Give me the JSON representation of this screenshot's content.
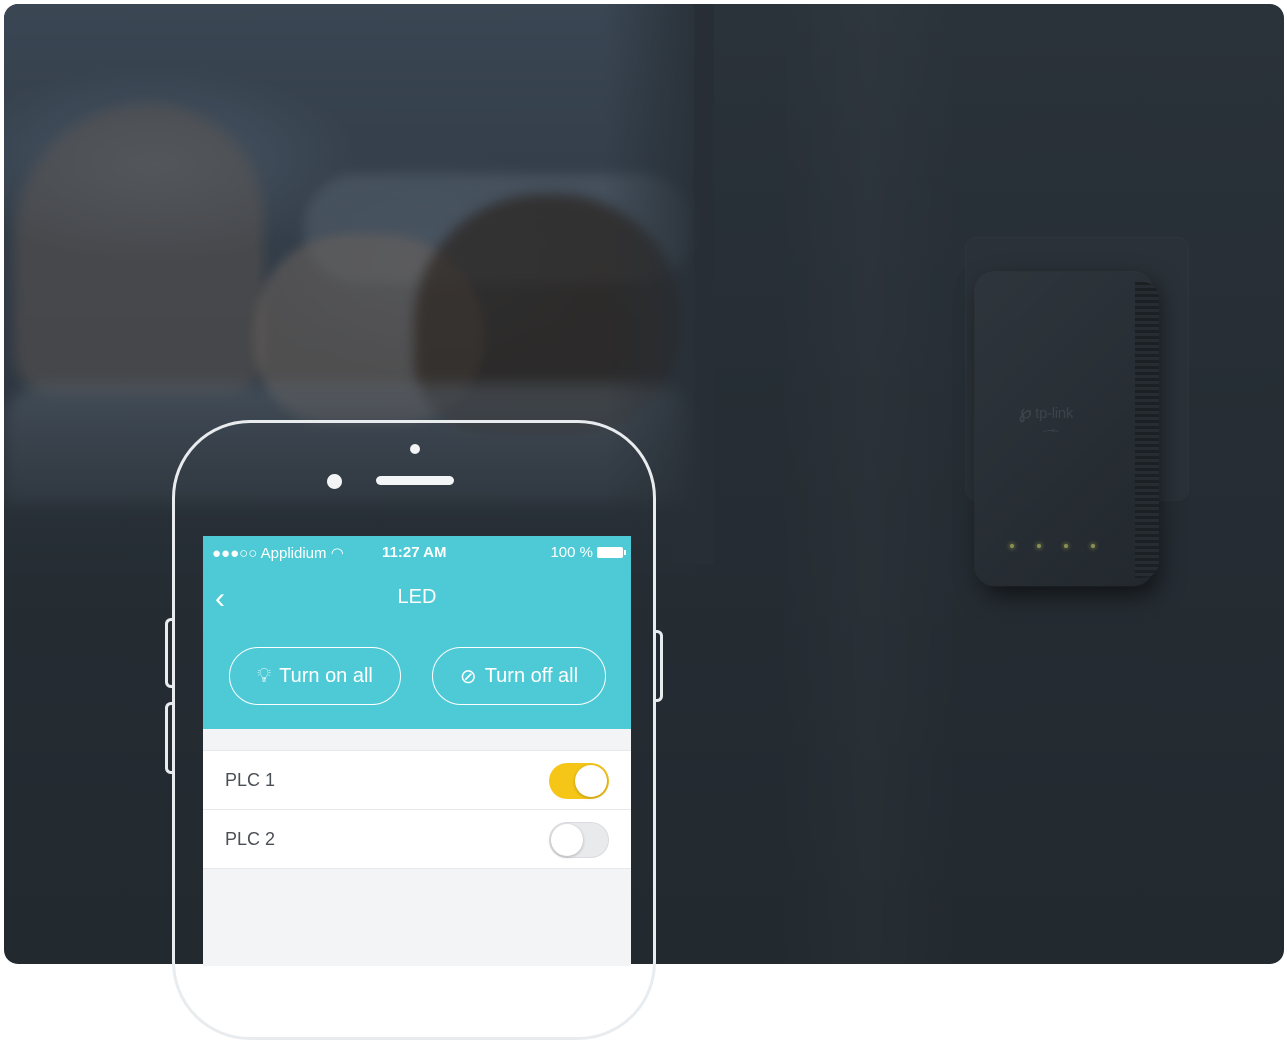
{
  "colors": {
    "appbar": "#4ecad6",
    "toggle_on": "#f5c518",
    "toggle_off": "#e9eaec",
    "background": "#262d34"
  },
  "status_bar": {
    "carrier": "●●●○○ Applidium",
    "wifi_icon": "wifi-icon",
    "time": "11:27 AM",
    "battery": "100 %"
  },
  "app": {
    "back_icon": "chevron-left-icon",
    "title": "LED",
    "turn_on_all": "Turn on all",
    "turn_on_icon": "lightbulb-on-icon",
    "turn_off_all": "Turn off all",
    "turn_off_icon": "lightbulb-off-icon"
  },
  "devices": [
    {
      "label": "PLC 1",
      "on": true
    },
    {
      "label": "PLC 2",
      "on": false
    }
  ],
  "adapter": {
    "brand": "tp-link",
    "led_count": 4
  }
}
